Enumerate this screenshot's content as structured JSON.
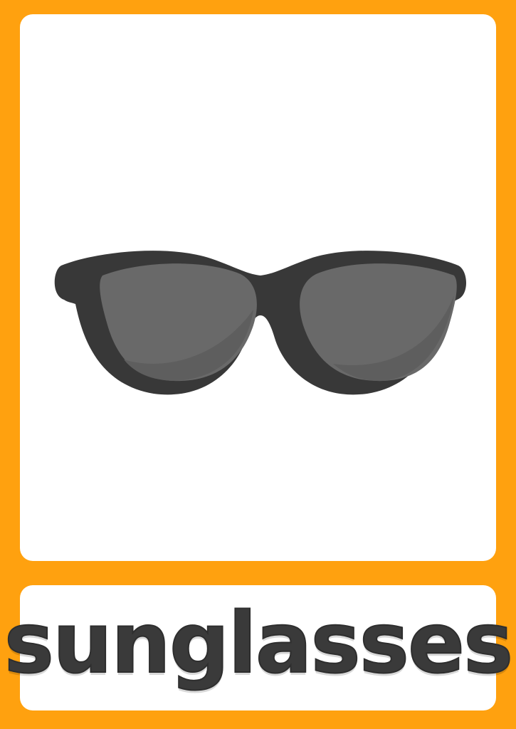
{
  "card": {
    "word": "sunglasses",
    "picture_icon": "sunglasses-icon"
  },
  "colors": {
    "border": "#ffa10f",
    "panel": "#ffffff",
    "frame": "#383838",
    "lens": "#696969",
    "lens_shade": "#5c5c5c",
    "text": "#3a3a3a"
  }
}
